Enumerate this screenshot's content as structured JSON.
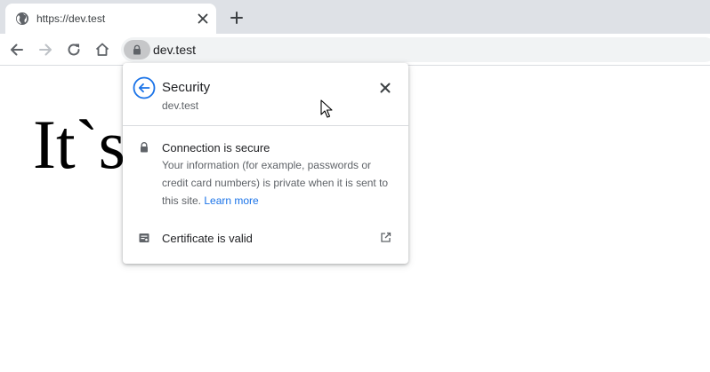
{
  "tab": {
    "title": "https://dev.test",
    "favicon": "globe-icon"
  },
  "toolbar": {
    "back": "arrow-left-icon",
    "forward": "arrow-right-icon",
    "reload": "reload-icon",
    "home": "home-icon",
    "url": "dev.test"
  },
  "page": {
    "heading": "It`s"
  },
  "popup": {
    "title": "Security",
    "subtitle": "dev.test",
    "connection": {
      "title": "Connection is secure",
      "description": "Your information (for example, passwords or credit card numbers) is private when it is sent to this site.",
      "learn_more": "Learn more"
    },
    "certificate": {
      "label": "Certificate is valid"
    }
  },
  "colors": {
    "accent": "#1a73e8",
    "tabstrip": "#dee1e6",
    "omnibox": "#f1f3f4",
    "lock_chip": "#c6c7c9"
  }
}
